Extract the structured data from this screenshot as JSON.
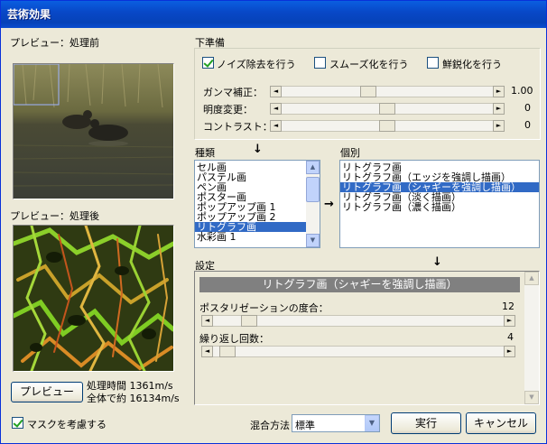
{
  "window": {
    "title": "芸術効果"
  },
  "preview_before": {
    "label": "プレビュー：処理前"
  },
  "preview_after": {
    "label": "プレビュー：処理後"
  },
  "preview_button": {
    "label": "プレビュー"
  },
  "timing": {
    "line1": "処理時間 1361m/s",
    "line2": "全体で約 16134m/s"
  },
  "mask": {
    "label": "マスクを考慮する",
    "checked": true
  },
  "prep": {
    "label": "下準備",
    "options": [
      {
        "label": "ノイズ除去を行う",
        "checked": true
      },
      {
        "label": "スムーズ化を行う",
        "checked": false
      },
      {
        "label": "鮮鋭化を行う",
        "checked": false
      }
    ],
    "sliders": [
      {
        "label": "ガンマ補正：",
        "value": "1.00",
        "level": 0.4
      },
      {
        "label": "明度変更：",
        "value": "0",
        "level": 0.5
      },
      {
        "label": "コントラスト：",
        "value": "0",
        "level": 0.5
      }
    ]
  },
  "types": {
    "label": "種類",
    "items": [
      "セル画",
      "パステル画",
      "ペン画",
      "ポスター画",
      "ポップアップ画 1",
      "ポップアップ画 2",
      "リトグラフ画",
      "水彩画 1"
    ],
    "selected_index": 6
  },
  "individual": {
    "label": "個別",
    "items": [
      "リトグラフ画",
      "リトグラフ画（エッジを強調し描画）",
      "リトグラフ画（シャギーを強調し描画）",
      "リトグラフ画（淡く描画）",
      "リトグラフ画（濃く描画）"
    ],
    "selected_index": 2
  },
  "settings": {
    "label": "設定",
    "banner": "リトグラフ画（シャギーを強調し描画）",
    "sliders": [
      {
        "label": "ポスタリゼーションの度合：",
        "value": "12",
        "level": 0.1
      },
      {
        "label": "繰り返し回数：",
        "value": "4",
        "level": 0.02
      }
    ]
  },
  "blend": {
    "label": "混合方法：",
    "value": "標準"
  },
  "run_button": {
    "label": "実行"
  },
  "cancel_button": {
    "label": "キャンセル"
  },
  "icons": {
    "arrow": "down-arrow-icon",
    "right_arrow": "right-arrow-icon"
  }
}
